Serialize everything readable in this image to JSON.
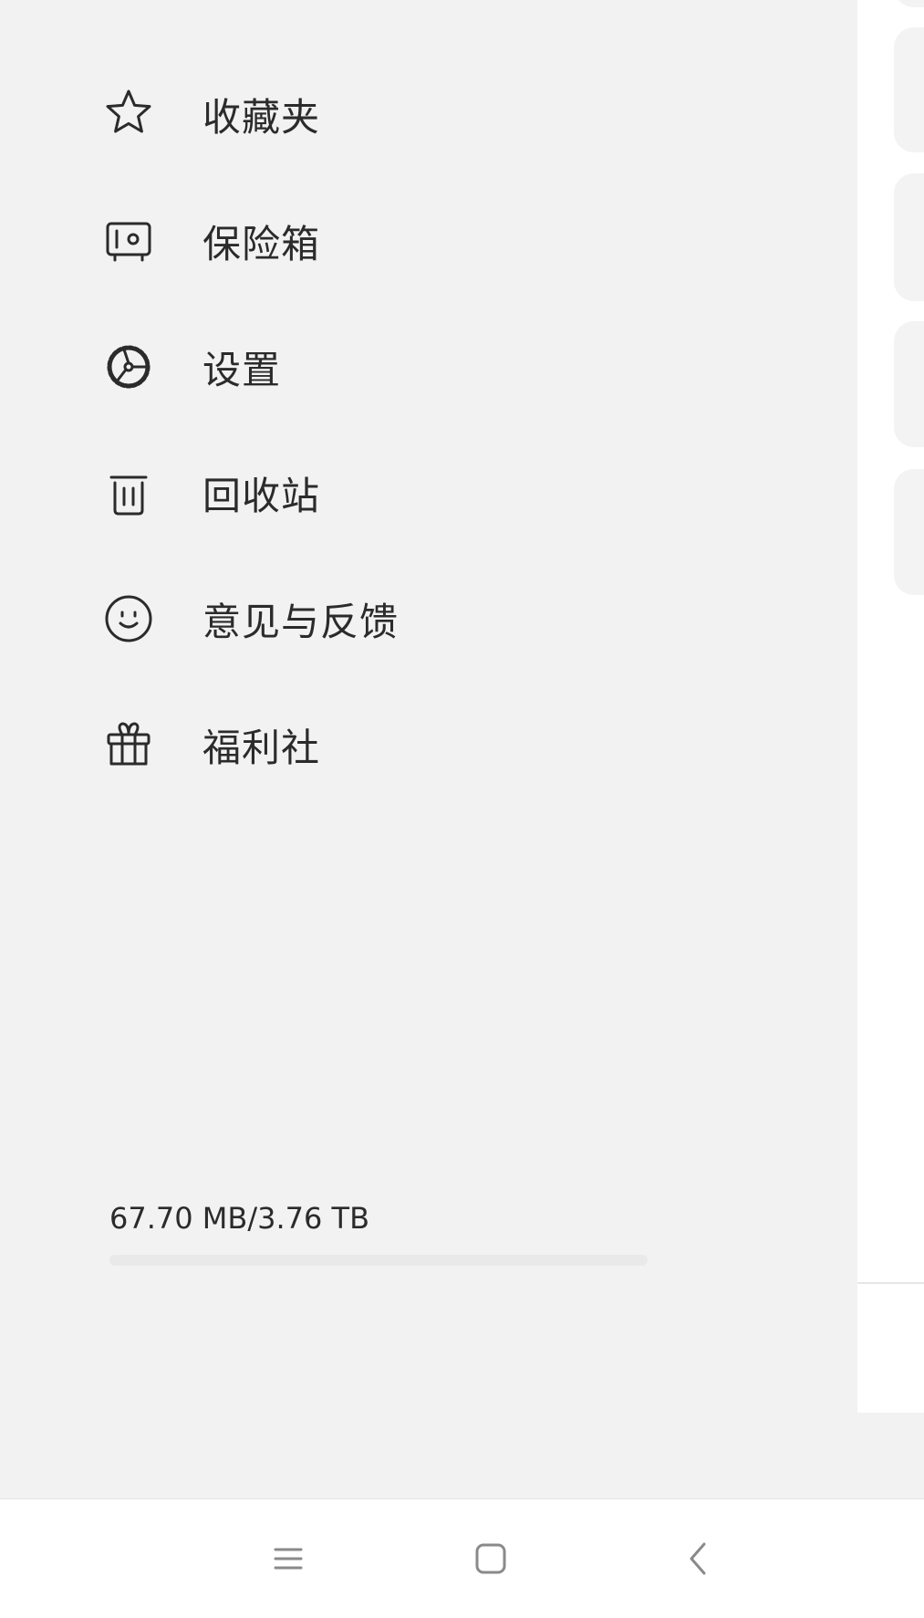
{
  "drawer": {
    "items": [
      {
        "label": "收藏夹",
        "icon": "star-icon"
      },
      {
        "label": "保险箱",
        "icon": "safe-icon"
      },
      {
        "label": "设置",
        "icon": "gear-icon"
      },
      {
        "label": "回收站",
        "icon": "trash-icon"
      },
      {
        "label": "意见与反馈",
        "icon": "smiley-icon"
      },
      {
        "label": "福利社",
        "icon": "gift-icon"
      }
    ],
    "storage": {
      "text": "67.70 MB/3.76 TB",
      "used_fraction": 1.76e-05
    }
  },
  "system_nav": {
    "buttons": [
      "menu-icon",
      "home-icon",
      "back-icon"
    ]
  },
  "colors": {
    "drawer_bg": "#f2f2f2",
    "text": "#2b2b2b",
    "storage_track": "#e9e9e9",
    "storage_fill": "#3a7bff"
  }
}
